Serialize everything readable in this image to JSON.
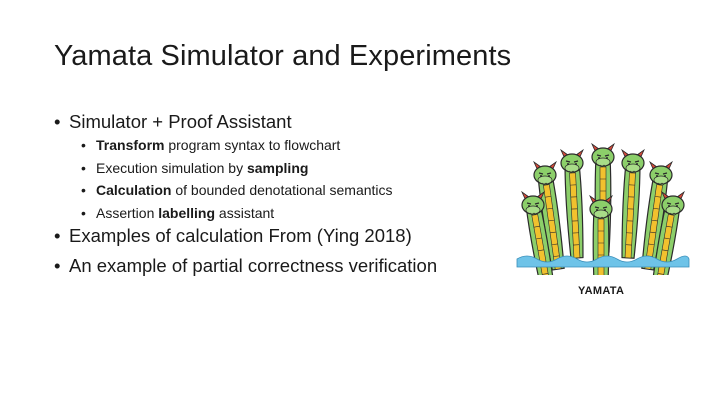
{
  "slide": {
    "title": "Yamata Simulator and Experiments",
    "bullet_glyph": "•",
    "bullets": [
      {
        "text": "Simulator + Proof Assistant",
        "sub": [
          {
            "bold": "Transform",
            "rest": " program syntax to flowchart"
          },
          {
            "pre": "Execution simulation by ",
            "bold": "sampling"
          },
          {
            "bold": "Calculation",
            "rest": " of bounded denotational semantics"
          },
          {
            "pre": "Assertion ",
            "bold": "labelling",
            "rest": " assistant"
          }
        ]
      },
      {
        "text": "Examples of calculation From (Ying 2018)"
      },
      {
        "text": "An example of partial correctness verification"
      }
    ],
    "image_caption": "YAMATA",
    "image_icon": "yamata-hydra-dragon-icon",
    "colors": {
      "dragon_green": "#8ccf6a",
      "belly_yellow": "#f2c12e",
      "water_blue": "#6ec3e8",
      "outline": "#2b2b2b",
      "horn": "#d84a3a"
    }
  }
}
